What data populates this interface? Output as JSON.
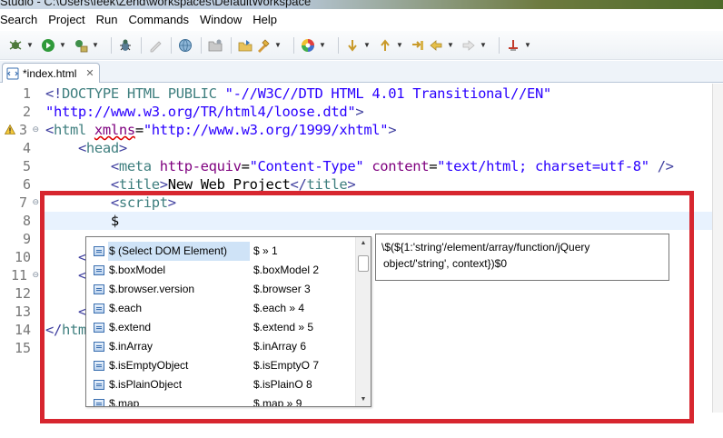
{
  "window": {
    "title": "Studio - C:\\Users\\feek\\Zend\\workspaces\\DefaultWorkspace"
  },
  "menu": {
    "items": [
      "Search",
      "Project",
      "Run",
      "Commands",
      "Window",
      "Help"
    ]
  },
  "toolbar": {
    "icons": [
      "debug-icon",
      "run-icon",
      "external-tools-icon",
      "bug-icon",
      "pen-icon",
      "globe-icon",
      "open-folder-icon",
      "open-file-icon",
      "paint-icon",
      "color-wheel-icon",
      "next-annotation-icon",
      "prev-annotation-icon",
      "last-edit-icon",
      "back-icon",
      "forward-icon",
      "pin-icon"
    ]
  },
  "editor_tab": {
    "label": "*index.html"
  },
  "code": {
    "lines": [
      {
        "n": "1",
        "text": "<!DOCTYPE HTML PUBLIC \"-//W3C//DTD HTML 4.01 Transitional//EN\""
      },
      {
        "n": "",
        "text": "\"http://www.w3.org/TR/html4/loose.dtd\">"
      },
      {
        "n": "3",
        "text": "<html xmlns=\"http://www.w3.org/1999/xhtml\">"
      },
      {
        "n": "4",
        "text": "    <head>"
      },
      {
        "n": "5",
        "text": "        <meta http-equiv=\"Content-Type\" content=\"text/html; charset=utf-8\" />"
      },
      {
        "n": "6",
        "text": "        <title>New Web Project</title>"
      },
      {
        "n": "7",
        "text": "        <script>"
      },
      {
        "n": "8",
        "text": "        $"
      },
      {
        "n": "9",
        "text": ""
      },
      {
        "n": "10",
        "text": "    <"
      },
      {
        "n": "11",
        "text": "    <"
      },
      {
        "n": "12",
        "text": ""
      },
      {
        "n": "13",
        "text": "    <"
      },
      {
        "n": "14",
        "text": "</htm"
      },
      {
        "n": "15",
        "text": ""
      }
    ],
    "line_2_number": "2"
  },
  "content_assist": {
    "proposals": [
      {
        "name": "$ (Select DOM Element)",
        "detail": "$ » 1"
      },
      {
        "name": "$.boxModel",
        "detail": "$.boxModel 2"
      },
      {
        "name": "$.browser.version",
        "detail": "$.browser  3"
      },
      {
        "name": "$.each",
        "detail": "$.each » 4"
      },
      {
        "name": "$.extend",
        "detail": "$.extend » 5"
      },
      {
        "name": "$.inArray",
        "detail": "$.inArray  6"
      },
      {
        "name": "$.isEmptyObject",
        "detail": "$.isEmptyO 7"
      },
      {
        "name": "$.isPlainObject",
        "detail": "$.isPlainO 8"
      },
      {
        "name": "$.map",
        "detail": "$.map » 9"
      }
    ]
  },
  "doc_popup": {
    "line1": "\\$(${1:'string'/element/array/function/jQuery",
    "line2": "object/'string', context})$0"
  },
  "colors": {
    "highlight": "#d7262f",
    "selection": "#cfe3f7",
    "current_line": "#e8f2fe"
  }
}
